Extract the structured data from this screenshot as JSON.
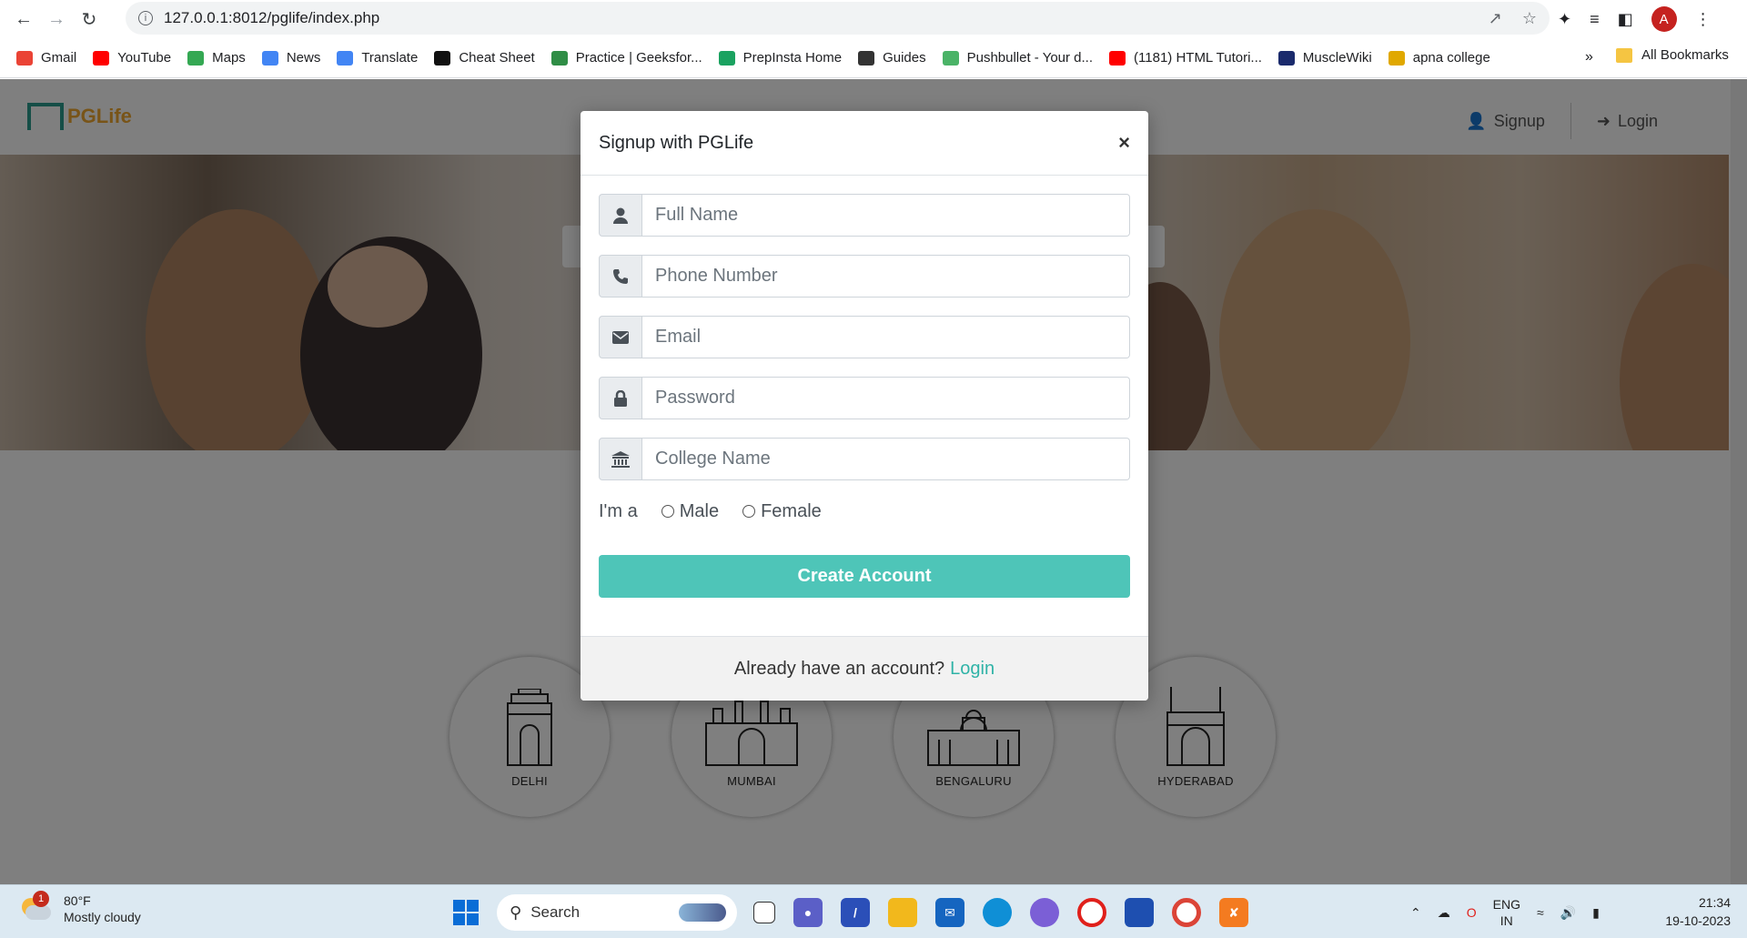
{
  "browser": {
    "url": "127.0.0.1:8012/pglife/index.php",
    "profile_initial": "A",
    "bookmarks": [
      {
        "label": "Gmail",
        "icon": "gmail-icon",
        "color": "#ea4335"
      },
      {
        "label": "YouTube",
        "icon": "youtube-icon",
        "color": "#ff0000"
      },
      {
        "label": "Maps",
        "icon": "maps-icon",
        "color": "#34a853"
      },
      {
        "label": "News",
        "icon": "news-icon",
        "color": "#4285f4"
      },
      {
        "label": "Translate",
        "icon": "translate-icon",
        "color": "#4285f4"
      },
      {
        "label": "Cheat Sheet",
        "icon": "cheatsheet-icon",
        "color": "#111111"
      },
      {
        "label": "Practice | Geeksfor...",
        "icon": "geeksforgeeks-icon",
        "color": "#2f8d46"
      },
      {
        "label": "PrepInsta Home",
        "icon": "prepinsta-icon",
        "color": "#1aa260"
      },
      {
        "label": "Guides",
        "icon": "guides-icon",
        "color": "#333333"
      },
      {
        "label": "Pushbullet - Your d...",
        "icon": "pushbullet-icon",
        "color": "#4ab367"
      },
      {
        "label": "(1181) HTML Tutori...",
        "icon": "youtube-icon",
        "color": "#ff0000"
      },
      {
        "label": "MuscleWiki",
        "icon": "musclewiki-icon",
        "color": "#1a2a6c"
      },
      {
        "label": "apna college",
        "icon": "apnacollege-icon",
        "color": "#e0a800"
      }
    ],
    "more_label": "»",
    "all_bookmarks": "All Bookmarks"
  },
  "site": {
    "logo_text": "PGLife",
    "nav": {
      "signup": "Signup",
      "login": "Login"
    },
    "cities": [
      {
        "name": "DELHI"
      },
      {
        "name": "MUMBAI"
      },
      {
        "name": "BENGALURU"
      },
      {
        "name": "HYDERABAD"
      }
    ]
  },
  "modal": {
    "title": "Signup with PGLife",
    "close": "×",
    "fields": [
      {
        "placeholder": "Full Name",
        "icon": "user-icon"
      },
      {
        "placeholder": "Phone Number",
        "icon": "phone-icon"
      },
      {
        "placeholder": "Email",
        "icon": "envelope-icon"
      },
      {
        "placeholder": "Password",
        "icon": "lock-icon"
      },
      {
        "placeholder": "College Name",
        "icon": "university-icon"
      }
    ],
    "gender_label": "I'm a",
    "gender_options": [
      "Male",
      "Female"
    ],
    "submit": "Create Account",
    "footer_text": "Already have an account?",
    "footer_link": "Login",
    "accent": "#4ec5b8"
  },
  "taskbar": {
    "weather_badge": "1",
    "temperature": "80°F",
    "condition": "Mostly cloudy",
    "search": "Search",
    "lang_top": "ENG",
    "lang_bottom": "IN",
    "time": "21:34",
    "date": "19-10-2023"
  }
}
